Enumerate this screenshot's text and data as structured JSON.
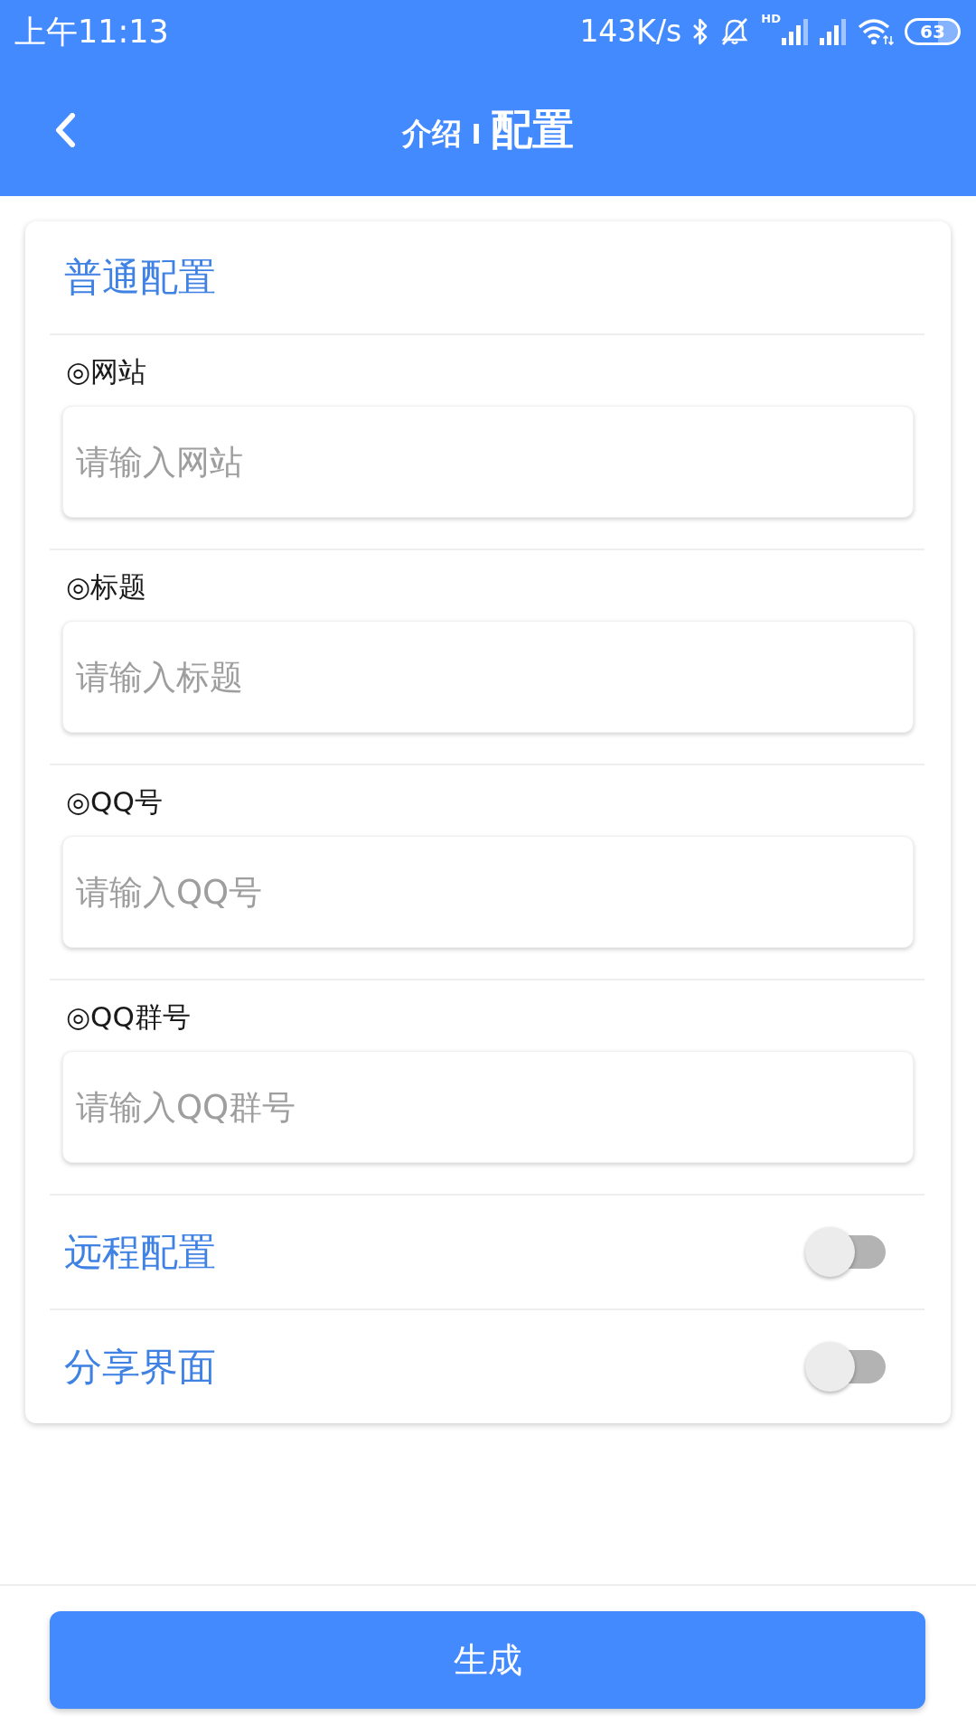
{
  "status_bar": {
    "time": "上午11:13",
    "speed": "143K/s",
    "hd_label": "HD",
    "battery": "63"
  },
  "header": {
    "section": "介绍",
    "separator": "I",
    "title": "配置"
  },
  "card": {
    "title": "普通配置",
    "fields": [
      {
        "label": "◎网站",
        "placeholder": "请输入网站"
      },
      {
        "label": "◎标题",
        "placeholder": "请输入标题"
      },
      {
        "label": "◎QQ号",
        "placeholder": "请输入QQ号"
      },
      {
        "label": "◎QQ群号",
        "placeholder": "请输入QQ群号"
      }
    ],
    "toggles": [
      {
        "label": "远程配置",
        "on": false
      },
      {
        "label": "分享界面",
        "on": false
      }
    ]
  },
  "submit_button": "生成"
}
